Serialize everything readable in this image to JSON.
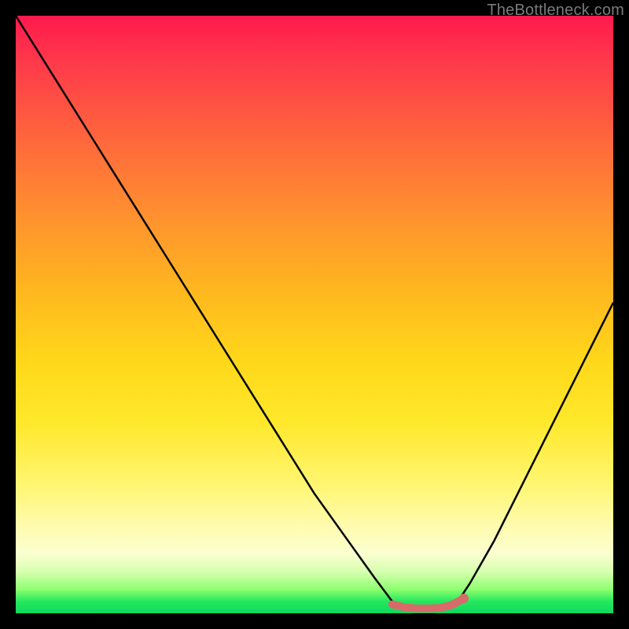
{
  "watermark": "TheBottleneck.com",
  "chart_data": {
    "type": "line",
    "title": "",
    "xlabel": "",
    "ylabel": "",
    "xlim": [
      0,
      100
    ],
    "ylim": [
      0,
      100
    ],
    "grid": false,
    "series": [
      {
        "name": "bottleneck-curve",
        "x": [
          0,
          5,
          10,
          15,
          20,
          25,
          30,
          35,
          40,
          45,
          50,
          55,
          60,
          63,
          65,
          68,
          70,
          72,
          74,
          76,
          80,
          85,
          90,
          95,
          100
        ],
        "values": [
          100,
          92,
          84,
          76,
          68,
          60,
          52,
          44,
          36,
          28,
          20,
          13,
          6,
          2,
          1,
          1,
          1,
          1,
          2,
          5,
          12,
          22,
          32,
          42,
          52
        ]
      },
      {
        "name": "highlight-segment",
        "x": [
          63,
          65,
          67,
          69,
          71,
          73,
          75
        ],
        "values": [
          1.5,
          1.0,
          0.8,
          0.8,
          0.9,
          1.4,
          2.5
        ]
      }
    ],
    "colors": {
      "curve": "#000000",
      "highlight": "#d86a6a",
      "gradient_top": "#ff1a4d",
      "gradient_bottom": "#0fd85f"
    }
  }
}
